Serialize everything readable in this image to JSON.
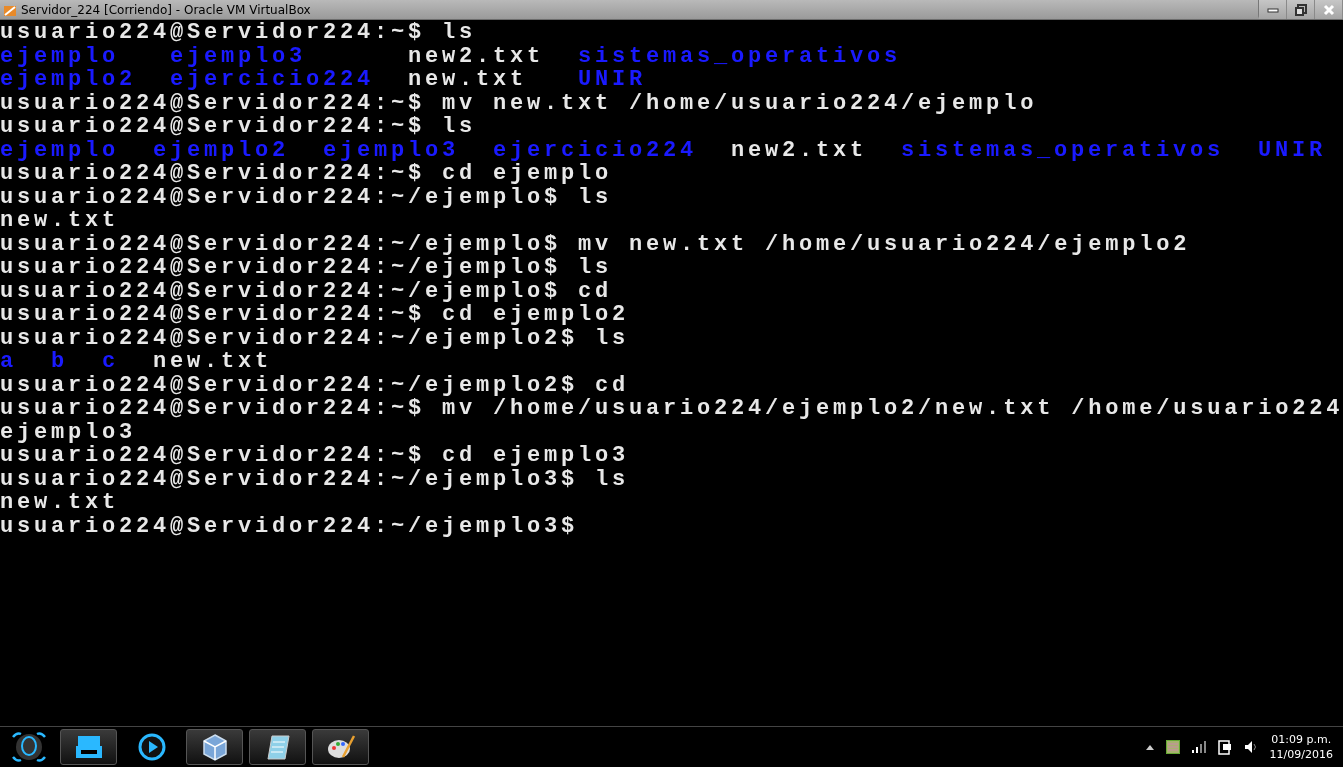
{
  "window": {
    "title": "Servidor_224 [Corriendo] - Oracle VM VirtualBox"
  },
  "terminal": {
    "lines": [
      {
        "kind": "text",
        "text": "usuario224@Servidor224:~$ ls"
      },
      {
        "kind": "listing",
        "columns": [
          [
            {
              "text": "ejemplo",
              "kind": "dir"
            },
            {
              "text": "ejemplo2",
              "kind": "dir"
            }
          ],
          [
            {
              "text": "ejemplo3",
              "kind": "dir"
            },
            {
              "text": "ejercicio224",
              "kind": "dir"
            }
          ],
          [
            {
              "text": "new2.txt",
              "kind": "file"
            },
            {
              "text": "new.txt",
              "kind": "file"
            }
          ],
          [
            {
              "text": "sistemas_operativos",
              "kind": "dir"
            },
            {
              "text": "UNIR",
              "kind": "dir"
            }
          ]
        ]
      },
      {
        "kind": "text",
        "text": "usuario224@Servidor224:~$ mv new.txt /home/usuario224/ejemplo"
      },
      {
        "kind": "text",
        "text": "usuario224@Servidor224:~$ ls"
      },
      {
        "kind": "listing",
        "columns": [
          [
            {
              "text": "ejemplo",
              "kind": "dir"
            }
          ],
          [
            {
              "text": "ejemplo2",
              "kind": "dir"
            }
          ],
          [
            {
              "text": "ejemplo3",
              "kind": "dir"
            }
          ],
          [
            {
              "text": "ejercicio224",
              "kind": "dir"
            }
          ],
          [
            {
              "text": "new2.txt",
              "kind": "file"
            }
          ],
          [
            {
              "text": "sistemas_operativos",
              "kind": "dir"
            }
          ],
          [
            {
              "text": "UNIR",
              "kind": "dir"
            }
          ]
        ]
      },
      {
        "kind": "text",
        "text": "usuario224@Servidor224:~$ cd ejemplo"
      },
      {
        "kind": "text",
        "text": "usuario224@Servidor224:~/ejemplo$ ls"
      },
      {
        "kind": "listing",
        "columns": [
          [
            {
              "text": "new.txt",
              "kind": "file"
            }
          ]
        ]
      },
      {
        "kind": "text",
        "text": "usuario224@Servidor224:~/ejemplo$ mv new.txt /home/usuario224/ejemplo2"
      },
      {
        "kind": "text",
        "text": "usuario224@Servidor224:~/ejemplo$ ls"
      },
      {
        "kind": "text",
        "text": "usuario224@Servidor224:~/ejemplo$ cd"
      },
      {
        "kind": "text",
        "text": "usuario224@Servidor224:~$ cd ejemplo2"
      },
      {
        "kind": "text",
        "text": "usuario224@Servidor224:~/ejemplo2$ ls"
      },
      {
        "kind": "listing",
        "columns": [
          [
            {
              "text": "a",
              "kind": "dir"
            }
          ],
          [
            {
              "text": "b",
              "kind": "dir"
            }
          ],
          [
            {
              "text": "c",
              "kind": "dir"
            }
          ],
          [
            {
              "text": "new.txt",
              "kind": "file"
            }
          ]
        ]
      },
      {
        "kind": "text",
        "text": "usuario224@Servidor224:~/ejemplo2$ cd"
      },
      {
        "kind": "text",
        "text": "usuario224@Servidor224:~$ mv /home/usuario224/ejemplo2/new.txt /home/usuario224"
      },
      {
        "kind": "text",
        "text": "ejemplo3"
      },
      {
        "kind": "text",
        "text": "usuario224@Servidor224:~$ cd ejemplo3"
      },
      {
        "kind": "text",
        "text": "usuario224@Servidor224:~/ejemplo3$ ls"
      },
      {
        "kind": "listing",
        "columns": [
          [
            {
              "text": "new.txt",
              "kind": "file"
            }
          ]
        ]
      },
      {
        "kind": "text",
        "text": "usuario224@Servidor224:~/ejemplo3$"
      }
    ]
  },
  "clock": {
    "time": "01:09 p.m.",
    "date": "11/09/2016"
  }
}
